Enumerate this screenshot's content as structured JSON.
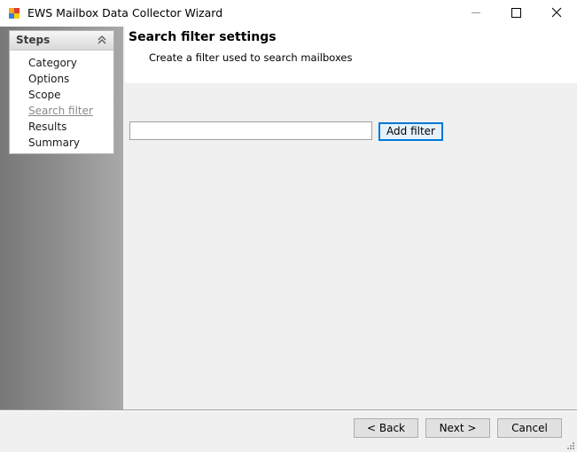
{
  "window": {
    "title": "EWS Mailbox Data Collector Wizard",
    "icon": "app-window-icon",
    "controls": [
      "minimize-icon",
      "maximize-icon",
      "close-icon"
    ]
  },
  "steps_panel": {
    "title": "Steps",
    "collapse_icon": "double-chevron-up-icon",
    "items": [
      {
        "label": "Category"
      },
      {
        "label": "Options"
      },
      {
        "label": "Scope"
      },
      {
        "label": "Search filter",
        "current": true
      },
      {
        "label": "Results"
      },
      {
        "label": "Summary"
      }
    ]
  },
  "page": {
    "title": "Search filter settings",
    "subtitle": "Create a filter used to search mailboxes"
  },
  "filter": {
    "value": "",
    "add_button": "Add filter"
  },
  "footer": {
    "back": "< Back",
    "next": "Next >",
    "cancel": "Cancel"
  },
  "colors": {
    "accent": "#0078d7",
    "current_step": "#8a8a8a"
  }
}
